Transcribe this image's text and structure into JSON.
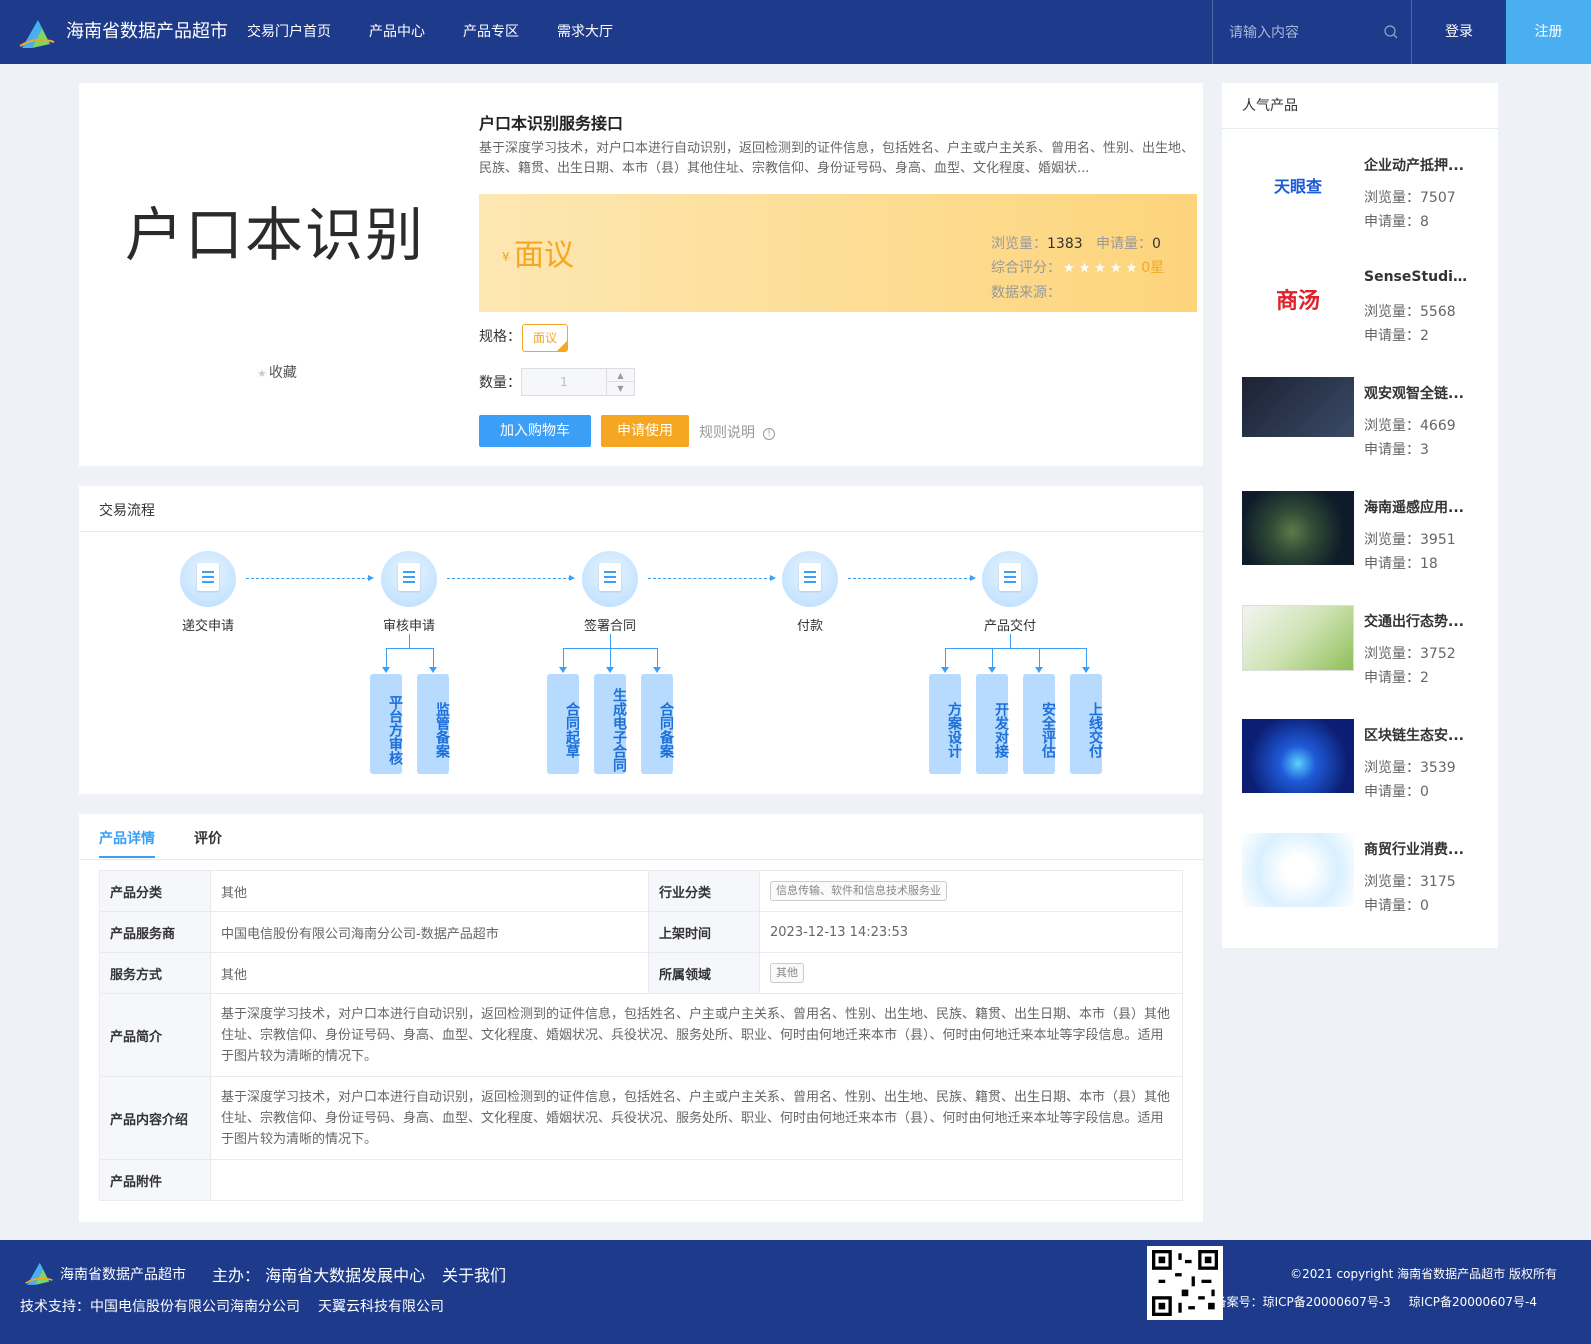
{
  "header": {
    "site_name": "海南省数据产品超市",
    "nav": [
      "交易门户首页",
      "产品中心",
      "产品专区",
      "需求大厅"
    ],
    "search_placeholder": "请输入内容",
    "login": "登录",
    "register": "注册"
  },
  "product": {
    "image_text": "户口本识别",
    "favorite": "收藏",
    "title": "户口本识别服务接口",
    "description": "基于深度学习技术，对户口本进行自动识别，返回检测到的证件信息，包括姓名、户主或户主关系、曾用名、性别、出生地、民族、籍贯、出生日期、本市（县）其他住址、宗教信仰、身份证号码、身高、血型、文化程度、婚姻状...",
    "currency": "¥",
    "price": "面议",
    "views_label": "浏览量：",
    "views": "1383",
    "applies_label": "申请量：",
    "applies": "0",
    "rating_label": "综合评分：",
    "rating_text": "0星",
    "source_label": "数据来源：",
    "spec_label": "规格：",
    "spec_value": "面议",
    "qty_label": "数量：",
    "qty_value": "1",
    "add_cart": "加入购物车",
    "apply": "申请使用",
    "rules": "规则说明"
  },
  "flow": {
    "title": "交易流程",
    "steps": [
      "递交申请",
      "审核申请",
      "签署合同",
      "付款",
      "产品交付"
    ],
    "sub": {
      "audit": [
        "平台方审核",
        "监管备案"
      ],
      "contract": [
        "合同起草",
        "生成电子合同",
        "合同备案"
      ],
      "deliver": [
        "方案设计",
        "开发对接",
        "安全评估",
        "上线交付"
      ]
    }
  },
  "details": {
    "tabs": [
      "产品详情",
      "评价"
    ],
    "rows": {
      "category_k": "产品分类",
      "category_v": "其他",
      "industry_k": "行业分类",
      "industry_v": "信息传输、软件和信息技术服务业",
      "provider_k": "产品服务商",
      "provider_v": "中国电信股份有限公司海南分公司-数据产品超市",
      "time_k": "上架时间",
      "time_v": "2023-12-13 14:23:53",
      "mode_k": "服务方式",
      "mode_v": "其他",
      "field_k": "所属领域",
      "field_v": "其他",
      "intro_k": "产品简介",
      "intro_v": "基于深度学习技术，对户口本进行自动识别，返回检测到的证件信息，包括姓名、户主或户主关系、曾用名、性别、出生地、民族、籍贯、出生日期、本市（县）其他住址、宗教信仰、身份证号码、身高、血型、文化程度、婚姻状况、兵役状况、服务处所、职业、何时由何地迁来本市（县）、何时由何地迁来本址等字段信息。适用于图片较为清晰的情况下。",
      "content_k": "产品内容介绍",
      "content_v": "基于深度学习技术，对户口本进行自动识别，返回检测到的证件信息，包括姓名、户主或户主关系、曾用名、性别、出生地、民族、籍贯、出生日期、本市（县）其他住址、宗教信仰、身份证号码、身高、血型、文化程度、婚姻状况、兵役状况、服务处所、职业、何时由何地迁来本市（县）、何时由何地迁来本址等字段信息。适用于图片较为清晰的情况下。",
      "attach_k": "产品附件"
    }
  },
  "popular": {
    "title": "人气产品",
    "views_label": "浏览量：",
    "applies_label": "申请量：",
    "items": [
      {
        "name": "企业动产抵押...",
        "views": "7507",
        "applies": "8",
        "thumb_text": "天眼查"
      },
      {
        "name": "SenseStudio...",
        "views": "5568",
        "applies": "2",
        "thumb_text": "商汤"
      },
      {
        "name": "观安观智全链...",
        "views": "4669",
        "applies": "3"
      },
      {
        "name": "海南遥感应用...",
        "views": "3951",
        "applies": "18"
      },
      {
        "name": "交通出行态势...",
        "views": "3752",
        "applies": "2"
      },
      {
        "name": "区块链生态安...",
        "views": "3539",
        "applies": "0"
      },
      {
        "name": "商贸行业消费...",
        "views": "3175",
        "applies": "0"
      }
    ]
  },
  "footer": {
    "site_name": "海南省数据产品超市",
    "host": "主办： 海南省大数据发展中心",
    "about": "关于我们",
    "tech_label": "技术支持：中国电信股份有限公司海南分公司",
    "tech_partner": "天翼云科技有限公司",
    "copyright": "©2021 copyright 海南省数据产品超市 版权所有",
    "icp1": "备案号：琼ICP备20000607号-3",
    "icp2": "琼ICP备20000607号-4"
  },
  "colors": {
    "header_bg": "#1e3a8a",
    "accent": "#3b9ff7",
    "orange": "#f5a623"
  }
}
